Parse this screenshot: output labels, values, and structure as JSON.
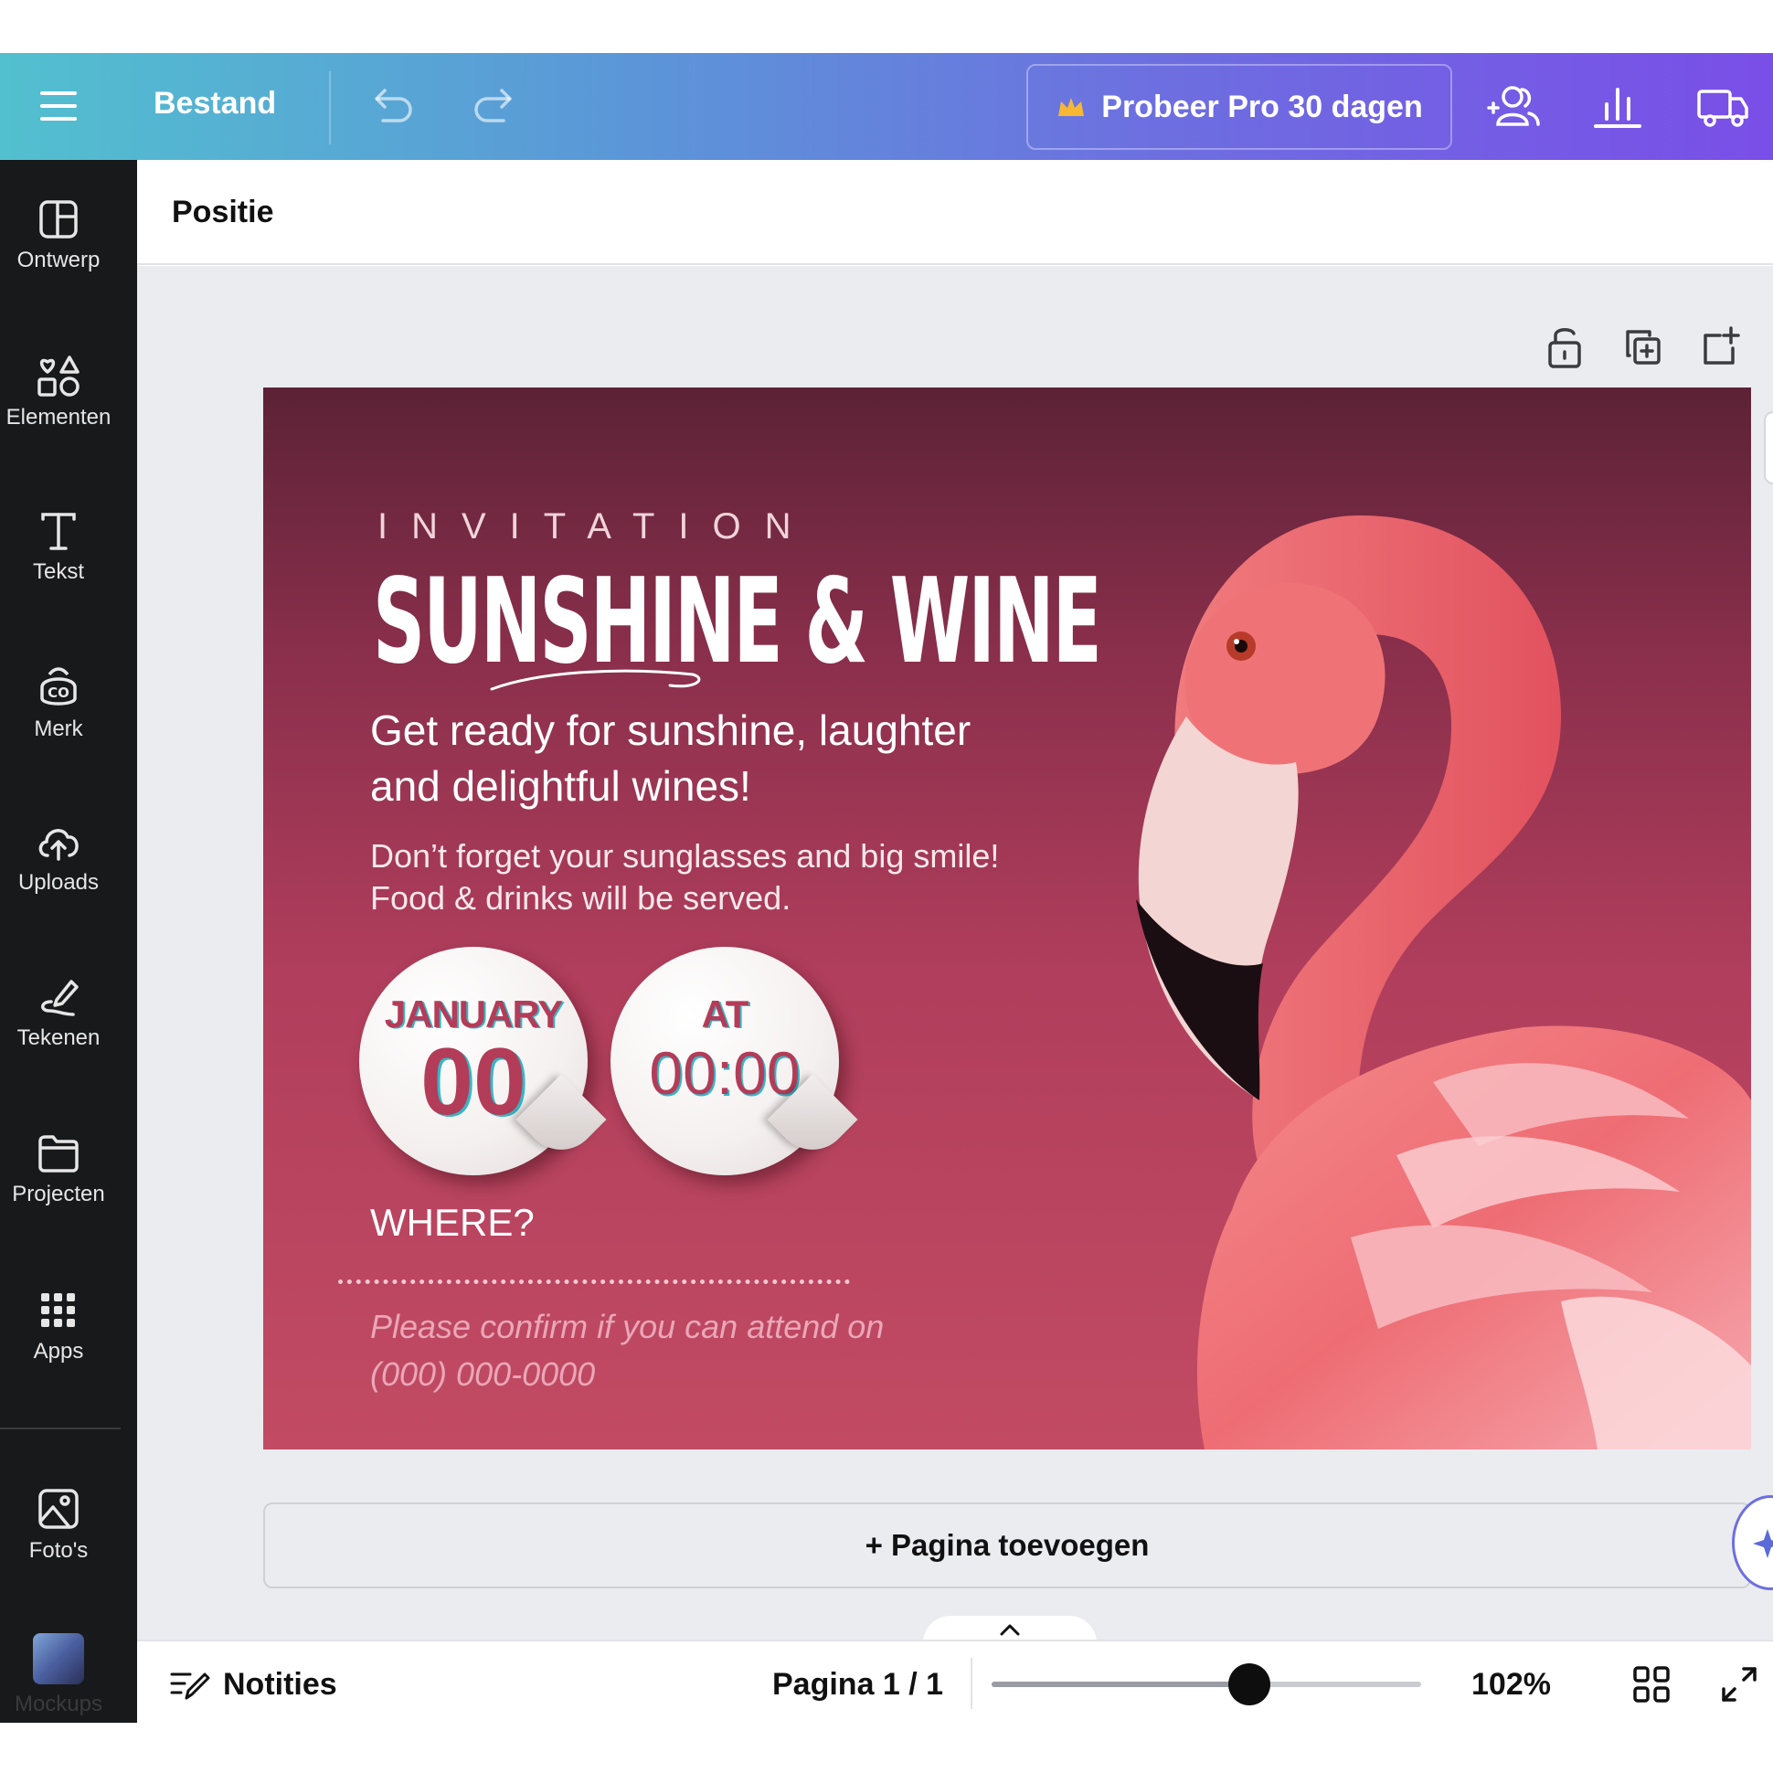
{
  "topbar": {
    "file_label": "Bestand",
    "pro_label": "Probeer Pro 30 dagen"
  },
  "sidebar": {
    "items": [
      {
        "label": "Ontwerp",
        "icon": "layout-icon"
      },
      {
        "label": "Elementen",
        "icon": "shapes-icon"
      },
      {
        "label": "Tekst",
        "icon": "text-icon"
      },
      {
        "label": "Merk",
        "icon": "brand-icon"
      },
      {
        "label": "Uploads",
        "icon": "cloud-upload-icon"
      },
      {
        "label": "Tekenen",
        "icon": "draw-icon"
      },
      {
        "label": "Projecten",
        "icon": "folder-icon"
      },
      {
        "label": "Apps",
        "icon": "apps-grid-icon"
      },
      {
        "label": "Foto's",
        "icon": "image-icon"
      },
      {
        "label": "Mockups",
        "icon": "mockups-thumbnail"
      }
    ]
  },
  "panel": {
    "title": "Positie"
  },
  "design": {
    "invitation": "INVITATION",
    "title": "SUNSHINE & WINE",
    "lead_line1": "Get ready for sunshine, laughter",
    "lead_line2": "and delightful wines!",
    "sub_line1": "Don’t forget your sunglasses and big smile!",
    "sub_line2": "Food & drinks will be served.",
    "date_month": "JANUARY",
    "date_day": "00",
    "time_label": "AT",
    "time_value": "00:00",
    "where_label": "WHERE?",
    "confirm_line1": "Please confirm if you can attend on",
    "confirm_line2": "(000) 000-0000"
  },
  "add_page_label": "+ Pagina toevoegen",
  "bottombar": {
    "notes_label": "Notities",
    "page_indicator": "Pagina 1 / 1",
    "zoom_label": "102%",
    "zoom_fraction": 0.6
  },
  "colors": {
    "accent_gradient_start": "#52c0cf",
    "accent_gradient_end": "#7a4ee8",
    "design_background": "#c24b63",
    "sticker_text": "#b33c58"
  }
}
